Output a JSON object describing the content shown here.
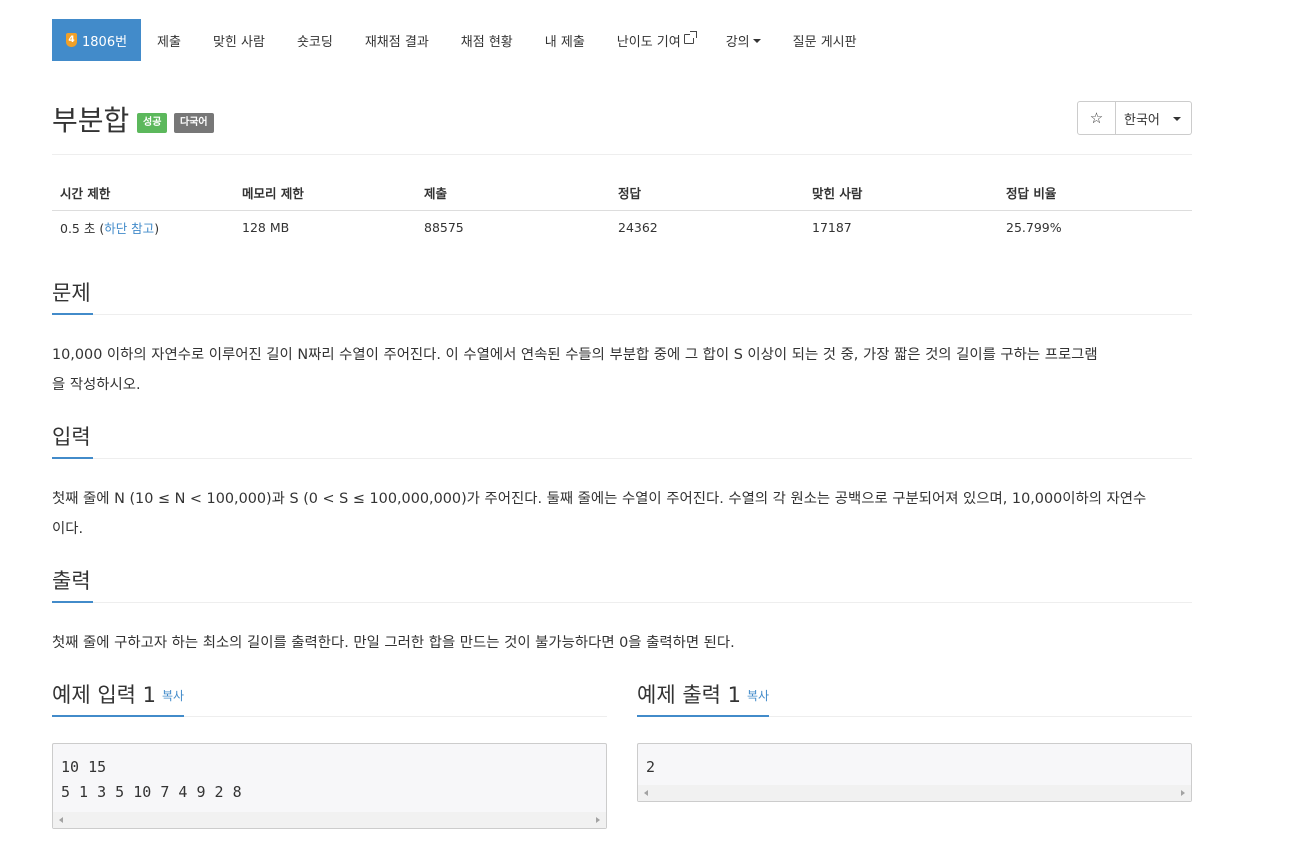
{
  "nav": {
    "tabs": [
      {
        "label": "1806번",
        "tier": "4",
        "active": true
      },
      {
        "label": "제출"
      },
      {
        "label": "맞힌 사람"
      },
      {
        "label": "숏코딩"
      },
      {
        "label": "재채점 결과"
      },
      {
        "label": "채점 현황"
      },
      {
        "label": "내 제출"
      },
      {
        "label": "난이도 기여"
      },
      {
        "label": "강의"
      },
      {
        "label": "질문 게시판"
      }
    ]
  },
  "problem": {
    "title": "부분합",
    "labels": {
      "success": "성공",
      "multilang": "다국어"
    },
    "star": "☆",
    "language": "한국어"
  },
  "info": {
    "headers": [
      "시간 제한",
      "메모리 제한",
      "제출",
      "정답",
      "맞힌 사람",
      "정답 비율"
    ],
    "time_prefix": "0.5 초 (",
    "time_link": "하단 참고",
    "time_suffix": ")",
    "memory": "128 MB",
    "submissions": "88575",
    "accepted": "24362",
    "solvers": "17187",
    "ratio": "25.799%"
  },
  "sections": {
    "description": {
      "heading": "문제",
      "line1": "10,000 이하의 자연수로 이루어진 길이 N짜리 수열이 주어진다. 이 수열에서 연속된 수들의 부분합 중에 그 합이 S 이상이 되는 것 중, 가장 짧은 것의 길이를 구하는 프로그램",
      "line2": "을 작성하시오."
    },
    "input": {
      "heading": "입력",
      "line1": "첫째 줄에 N (10 ≤ N < 100,000)과 S (0 < S ≤ 100,000,000)가 주어진다. 둘째 줄에는 수열이 주어진다. 수열의 각 원소는 공백으로 구분되어져 있으며, 10,000이하의 자연수",
      "line2": "이다."
    },
    "output": {
      "heading": "출력",
      "line1": "첫째 줄에 구하고자 하는 최소의 길이를 출력한다. 만일 그러한 합을 만드는 것이 불가능하다면 0을 출력하면 된다."
    }
  },
  "samples": {
    "input": {
      "heading": "예제 입력 1",
      "copy": "복사",
      "line1": "10 15",
      "line2": "5 1 3 5 10 7 4 9 2 8"
    },
    "output": {
      "heading": "예제 출력 1",
      "copy": "복사",
      "line1": "2"
    }
  }
}
